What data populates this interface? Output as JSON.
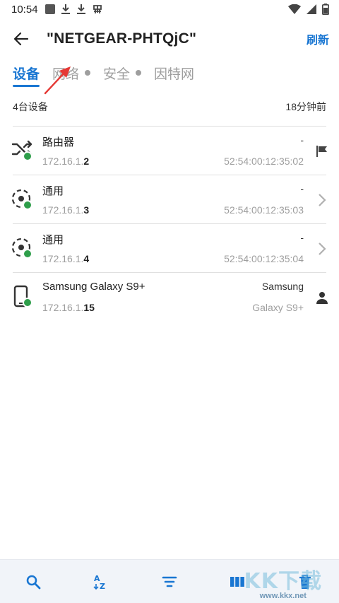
{
  "status_bar": {
    "time": "10:54",
    "icons": [
      "stop-square-icon",
      "download-icon",
      "download-icon",
      "bug-icon",
      "wifi-icon",
      "signal-icon",
      "battery-icon"
    ]
  },
  "header": {
    "title": "\"NETGEAR-PHTQjC\"",
    "refresh_label": "刷新"
  },
  "tabs": [
    {
      "label": "设备",
      "active": true
    },
    {
      "label": "网络",
      "active": false
    },
    {
      "label": "安全",
      "active": false
    },
    {
      "label": "因特网",
      "active": false
    }
  ],
  "summary": {
    "device_count": "4台设备",
    "updated": "18分钟前"
  },
  "devices": [
    {
      "name": "路由器",
      "ip_prefix": "172.16.1.",
      "ip_suffix": "2",
      "right_top": "-",
      "right_bottom": "52:54:00:12:35:02",
      "type_icon": "shuffle-icon",
      "action_icon": "flag-icon"
    },
    {
      "name": "通用",
      "ip_prefix": "172.16.1.",
      "ip_suffix": "3",
      "right_top": "-",
      "right_bottom": "52:54:00:12:35:03",
      "type_icon": "generic-device-icon",
      "action_icon": "chevron-right-icon"
    },
    {
      "name": "通用",
      "ip_prefix": "172.16.1.",
      "ip_suffix": "4",
      "right_top": "-",
      "right_bottom": "52:54:00:12:35:04",
      "type_icon": "generic-device-icon",
      "action_icon": "chevron-right-icon"
    },
    {
      "name": "Samsung Galaxy S9+",
      "ip_prefix": "172.16.1.",
      "ip_suffix": "15",
      "right_top": "Samsung",
      "right_bottom": "Galaxy S9+",
      "type_icon": "phone-icon",
      "action_icon": "person-icon"
    }
  ],
  "bottom_bar": {
    "buttons": [
      "search-icon",
      "sort-az-icon",
      "filter-icon",
      "columns-icon",
      "delete-icon"
    ]
  },
  "watermark": {
    "logo": "KK下载",
    "url": "www.kkx.net"
  },
  "colors": {
    "accent": "#1976d2",
    "online": "#2e9e4a",
    "muted": "#9e9e9e"
  }
}
